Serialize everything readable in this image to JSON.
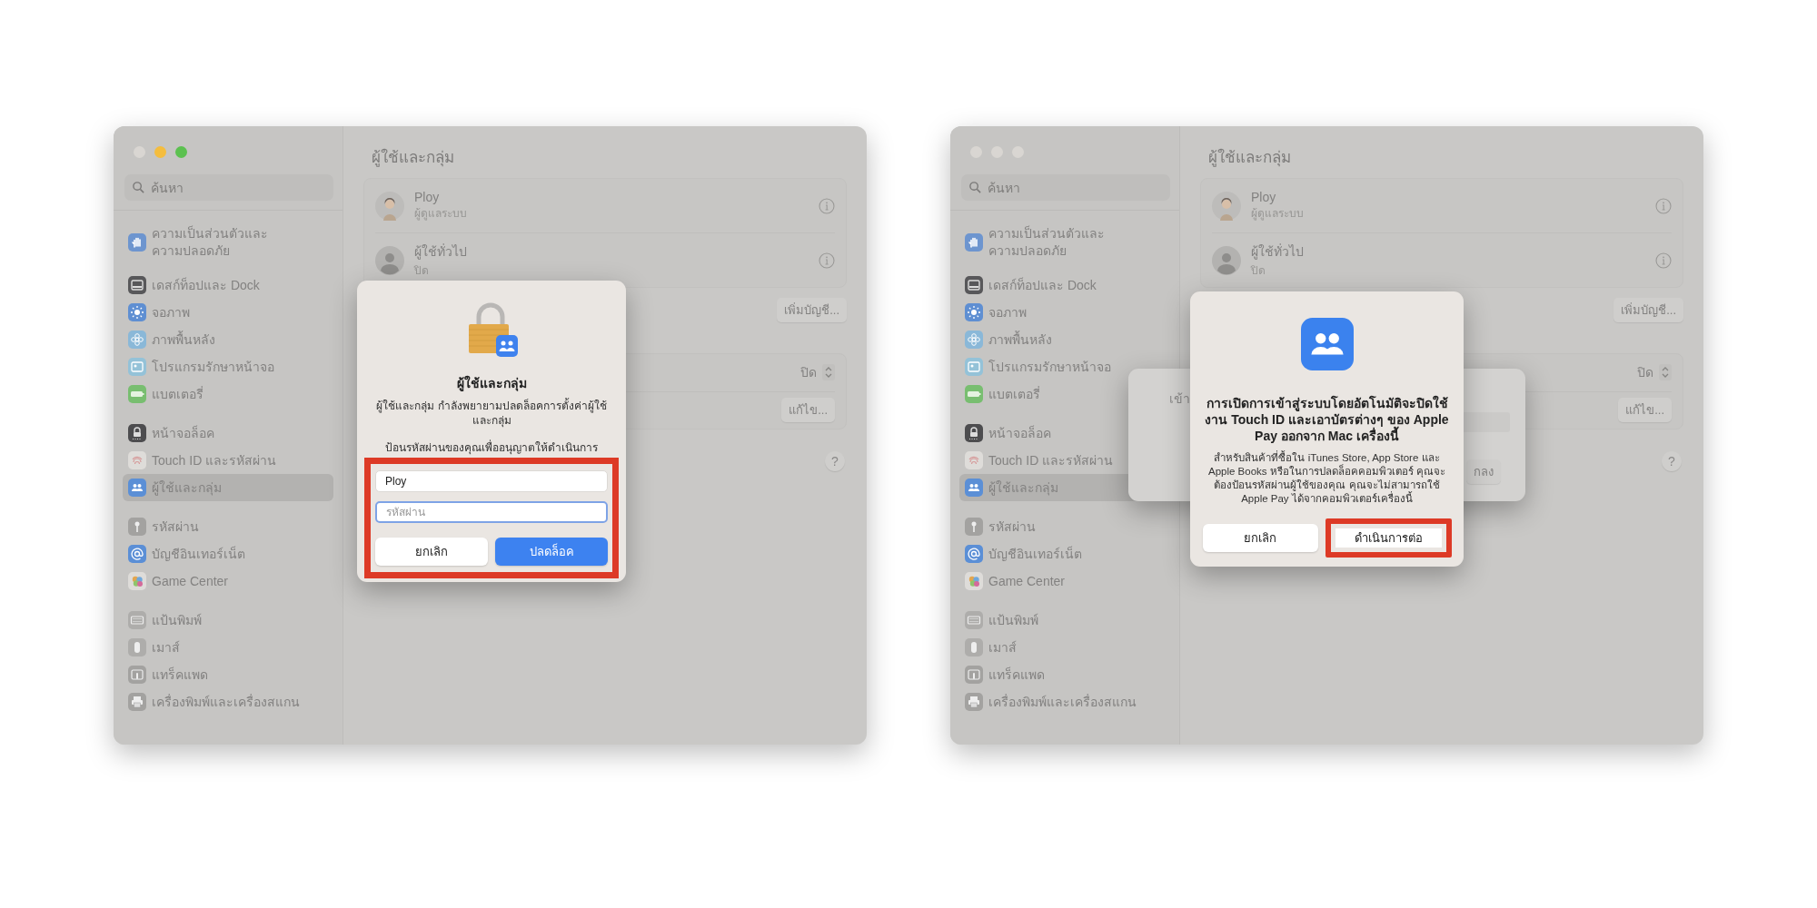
{
  "windows": [
    {
      "traffic_lights": [
        {
          "color": "#d9d6d2"
        },
        {
          "color": "#f4bd3e"
        },
        {
          "color": "#5cc150"
        }
      ],
      "sidebar": {
        "search": {
          "placeholder": "ค้นหา"
        },
        "groups": [
          [
            {
              "label": "ความเป็นส่วนตัวและ\nความปลอดภัย",
              "selected": false
            }
          ],
          [
            {
              "label": "เดสก์ท็อปและ Dock",
              "selected": false
            },
            {
              "label": "จอภาพ",
              "selected": false
            },
            {
              "label": "ภาพพื้นหลัง",
              "selected": false
            },
            {
              "label": "โปรแกรมรักษาหน้าจอ",
              "selected": false
            },
            {
              "label": "แบตเตอรี่",
              "selected": false
            }
          ],
          [
            {
              "label": "หน้าจอล็อค",
              "selected": false
            },
            {
              "label": "Touch ID และรหัสผ่าน",
              "selected": false
            },
            {
              "label": "ผู้ใช้และกลุ่ม",
              "selected": true
            }
          ],
          [
            {
              "label": "รหัสผ่าน",
              "selected": false
            },
            {
              "label": "บัญชีอินเทอร์เน็ต",
              "selected": false
            },
            {
              "label": "Game Center",
              "selected": false
            }
          ],
          [
            {
              "label": "แป้นพิมพ์",
              "selected": false
            },
            {
              "label": "เมาส์",
              "selected": false
            },
            {
              "label": "แทร็คแพด",
              "selected": false
            },
            {
              "label": "เครื่องพิมพ์และเครื่องสแกน",
              "selected": false
            }
          ]
        ]
      },
      "content": {
        "title": "ผู้ใช้และกลุ่ม",
        "users": [
          {
            "name": "Ploy",
            "role": "ผู้ดูแลระบบ",
            "kind": "memoji"
          },
          {
            "name": "ผู้ใช้ทั่วไป",
            "role": "ปิด",
            "kind": "generic"
          }
        ],
        "add_button": "เพิ่มบัญชี...",
        "settings": [
          {
            "kind": "popup",
            "value": "ปิด"
          },
          {
            "kind": "button",
            "label": "แก้ไข..."
          }
        ],
        "help": "?"
      },
      "dialogs": [
        {
          "kind": "unlock",
          "title": "ผู้ใช้และกลุ่ม",
          "message": "ผู้ใช้และกลุ่ม กำลังพยายามปลดล็อคการตั้งค่าผู้ใช้และกลุ่ม",
          "prompt": "ป้อนรหัสผ่านของคุณเพื่ออนุญาตให้ดำเนินการ",
          "highlighted": true,
          "fields": [
            {
              "value": "Ploy",
              "focused": false
            },
            {
              "placeholder": "รหัสผ่าน",
              "focused": true
            }
          ],
          "buttons": [
            {
              "label": "ยกเลิก",
              "primary": false
            },
            {
              "label": "ปลดล็อค",
              "primary": true
            }
          ]
        }
      ]
    },
    {
      "traffic_lights": [
        {
          "color": "#d9d6d2"
        },
        {
          "color": "#d9d6d2"
        },
        {
          "color": "#d9d6d2"
        }
      ],
      "sidebar": {
        "search": {
          "placeholder": "ค้นหา"
        },
        "groups": [
          [
            {
              "label": "ความเป็นส่วนตัวและ\nความปลอดภัย",
              "selected": false
            }
          ],
          [
            {
              "label": "เดสก์ท็อปและ Dock",
              "selected": false
            },
            {
              "label": "จอภาพ",
              "selected": false
            },
            {
              "label": "ภาพพื้นหลัง",
              "selected": false
            },
            {
              "label": "โปรแกรมรักษาหน้าจอ",
              "selected": false
            },
            {
              "label": "แบตเตอรี่",
              "selected": false
            }
          ],
          [
            {
              "label": "หน้าจอล็อค",
              "selected": false
            },
            {
              "label": "Touch ID และรหัสผ่าน",
              "selected": false
            },
            {
              "label": "ผู้ใช้และกลุ่ม",
              "selected": true
            }
          ],
          [
            {
              "label": "รหัสผ่าน",
              "selected": false
            },
            {
              "label": "บัญชีอินเทอร์เน็ต",
              "selected": false
            },
            {
              "label": "Game Center",
              "selected": false
            }
          ],
          [
            {
              "label": "แป้นพิมพ์",
              "selected": false
            },
            {
              "label": "เมาส์",
              "selected": false
            },
            {
              "label": "แทร็คแพด",
              "selected": false
            },
            {
              "label": "เครื่องพิมพ์และเครื่องสแกน",
              "selected": false
            }
          ]
        ]
      },
      "content": {
        "title": "ผู้ใช้และกลุ่ม",
        "users": [
          {
            "name": "Ploy",
            "role": "ผู้ดูแลระบบ",
            "kind": "memoji"
          },
          {
            "name": "ผู้ใช้ทั่วไป",
            "role": "ปิด",
            "kind": "generic"
          }
        ],
        "add_button": "เพิ่มบัญชี...",
        "settings": [
          {
            "kind": "popup",
            "value": "ปิด"
          },
          {
            "kind": "button",
            "label": "แก้ไข..."
          }
        ],
        "help": "?"
      },
      "dialogs": [
        {
          "kind": "sheet",
          "text": "เข้า",
          "button": "กลง"
        },
        {
          "kind": "confirm",
          "title": "การเปิดการเข้าสู่ระบบโดยอัตโนมัติจะปิดใช้งาน Touch ID และเอาบัตรต่างๆ ของ Apple Pay ออกจาก Mac เครื่องนี้",
          "message": "สำหรับสินค้าที่ซื้อใน iTunes Store, App Store และ Apple Books หรือในการปลดล็อคคอมพิวเตอร์ คุณจะต้องป้อนรหัสผ่านผู้ใช้ของคุณ คุณจะไม่สามารถใช้ Apple Pay ได้จากคอมพิวเตอร์เครื่องนี้",
          "buttons": [
            {
              "label": "ยกเลิก",
              "primary": false,
              "highlighted": false
            },
            {
              "label": "ดำเนินการต่อ",
              "primary": false,
              "highlighted": true
            }
          ]
        }
      ]
    }
  ]
}
